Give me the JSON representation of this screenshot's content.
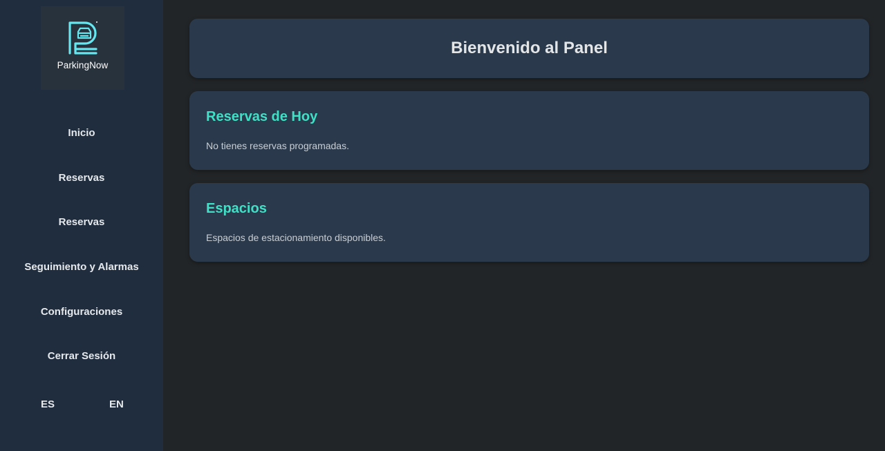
{
  "brand": {
    "name": "ParkingNow",
    "accent_color": "#3fe0c5",
    "logo_icon": "parking-p-car-icon"
  },
  "sidebar": {
    "items": [
      {
        "label": "Inicio"
      },
      {
        "label": "Reservas"
      },
      {
        "label": "Reservas"
      },
      {
        "label": "Seguimiento y Alarmas"
      },
      {
        "label": "Configuraciones"
      },
      {
        "label": "Cerrar Sesión"
      }
    ],
    "languages": [
      "ES",
      "EN"
    ]
  },
  "main": {
    "header": {
      "title": "Bienvenido al Panel"
    },
    "sections": [
      {
        "title": "Reservas de Hoy",
        "text": "No tienes reservas programadas."
      },
      {
        "title": "Espacios",
        "text": "Espacios de estacionamiento disponibles."
      }
    ]
  },
  "colors": {
    "background": "#222527",
    "sidebar": "#1f2d3e",
    "card": "#2a3a4c"
  }
}
